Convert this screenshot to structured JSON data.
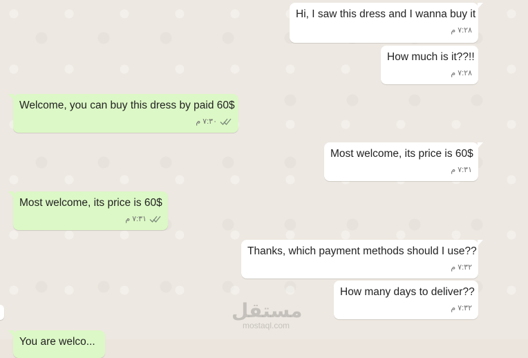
{
  "watermark": {
    "arabic": "مستقل",
    "latin": "mostaql.com"
  },
  "messages": [
    {
      "direction": "out",
      "text": "Hi, I saw this dress and I wanna buy it",
      "time": "٧:٢٨ م"
    },
    {
      "direction": "out",
      "text": "How much is it??!!",
      "time": "٧:٢٨ م"
    },
    {
      "direction": "in",
      "text": "Welcome, you can buy this dress by paid 60$",
      "time": "٧:٣٠ م",
      "ticks": "read"
    },
    {
      "direction": "out",
      "text": "Most welcome, its price is 60$",
      "time": "٧:٣١ م"
    },
    {
      "direction": "in",
      "text": "Most welcome, its price is 60$",
      "time": "٧:٣١ م",
      "ticks": "read"
    },
    {
      "direction": "out",
      "text": "Thanks, which payment methods should I use??",
      "time": "٧:٣٢ م"
    },
    {
      "direction": "out",
      "text": "How many days to deliver??",
      "time": "٧:٣٢ م"
    },
    {
      "direction": "in",
      "text": "You are welco..."
    }
  ],
  "colors": {
    "outgoing_bg": "#FFFFFF",
    "incoming_bg": "#DCF8C6",
    "background": "#ECE5DD",
    "tick": "#7a8a7a"
  }
}
